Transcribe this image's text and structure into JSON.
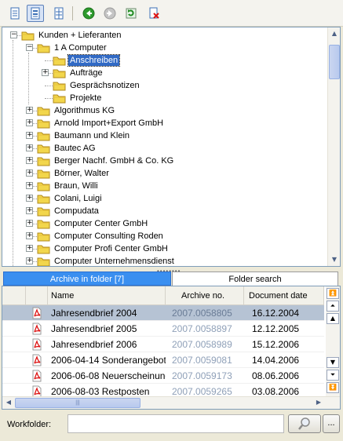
{
  "tree": {
    "root": "Kunden + Lieferanten",
    "first_customer": "1 A Computer",
    "subfolders": [
      "Anschreiben",
      "Aufträge",
      "Gesprächsnotizen",
      "Projekte"
    ],
    "selected": "Anschreiben",
    "customers": [
      "Algorithmus KG",
      "Arnold Import+Export GmbH",
      "Baumann und Klein",
      "Bautec AG",
      "Berger Nachf. GmbH & Co. KG",
      "Börner, Walter",
      "Braun, Willi",
      "Colani, Luigi",
      "Compudata",
      "Computer Center GmbH",
      "Computer Consulting Roden",
      "Computer Profi Center GmbH",
      "Computer Unternehmensdienst"
    ]
  },
  "tabs": {
    "archive": "Archive in folder [7]",
    "search": "Folder search"
  },
  "grid": {
    "columns": {
      "name": "Name",
      "archive": "Archive no.",
      "date": "Document date"
    },
    "rows": [
      {
        "name": "Jahresendbrief 2004",
        "archive": "2007.0058805",
        "date": "16.12.2004"
      },
      {
        "name": "Jahresendbrief 2005",
        "archive": "2007.0058897",
        "date": "12.12.2005"
      },
      {
        "name": "Jahresendbrief 2006",
        "archive": "2007.0058989",
        "date": "15.12.2006"
      },
      {
        "name": "2006-04-14 Sonderangebot",
        "archive": "2007.0059081",
        "date": "14.04.2006"
      },
      {
        "name": "2006-06-08 Neuerscheinung",
        "archive": "2007.0059173",
        "date": "08.06.2006"
      },
      {
        "name": "2006-08-03 Restposten",
        "archive": "2007.0059265",
        "date": "03.08.2006"
      }
    ]
  },
  "workfolder": {
    "label": "Workfolder:",
    "value": "",
    "browse_label": "..."
  },
  "splitter_glyph": "••••••••",
  "hscroll_grip": "|||",
  "colors": {
    "selection": "#316ac5",
    "tab_active": "#3a8ff0",
    "row_selected": "#b6c3d4",
    "folder": "#f2d64c"
  }
}
